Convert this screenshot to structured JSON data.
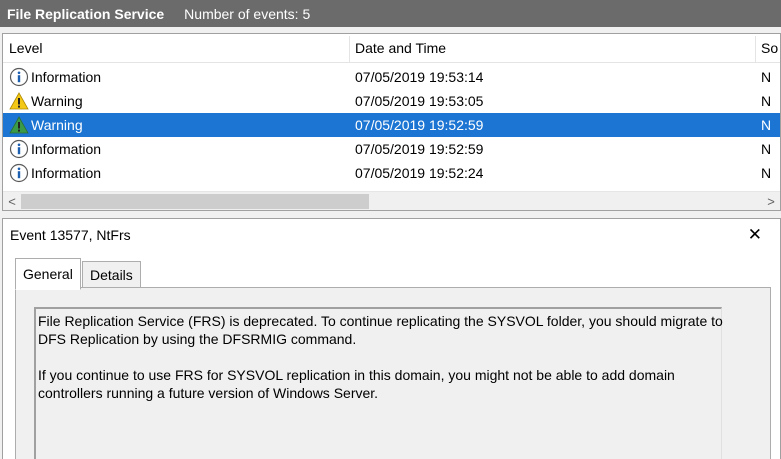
{
  "header": {
    "title": "File Replication Service",
    "event_count": "Number of events: 5"
  },
  "columns": {
    "level": "Level",
    "datetime": "Date and Time",
    "source": "So"
  },
  "events": [
    {
      "level": "Information",
      "datetime": "07/05/2019 19:53:14",
      "source": "N",
      "icon": "information-icon"
    },
    {
      "level": "Warning",
      "datetime": "07/05/2019 19:53:05",
      "source": "N",
      "icon": "warning-icon"
    },
    {
      "level": "Warning",
      "datetime": "07/05/2019 19:52:59",
      "source": "N",
      "icon": "warning-icon",
      "selected": true
    },
    {
      "level": "Information",
      "datetime": "07/05/2019 19:52:59",
      "source": "N",
      "icon": "information-icon"
    },
    {
      "level": "Information",
      "datetime": "07/05/2019 19:52:24",
      "source": "N",
      "icon": "information-icon"
    }
  ],
  "scrollbar": {
    "left_arrow": "<",
    "right_arrow": ">"
  },
  "detail": {
    "title": "Event 13577, NtFrs",
    "close": "✕",
    "tabs": [
      "General",
      "Details"
    ],
    "message": [
      "File Replication Service (FRS) is deprecated. To continue replicating the SYSVOL folder, you should migrate to DFS Replication by using the DFSRMIG command.",
      "If you continue to use FRS for SYSVOL replication in this domain, you might not be able  to add domain controllers running a future version of Windows Server."
    ]
  },
  "colors": {
    "header_bg": "#6b6b6b",
    "selection": "#1c75d3",
    "info_blue": "#1d5fb0",
    "warning_yellow": "#f4c816"
  }
}
